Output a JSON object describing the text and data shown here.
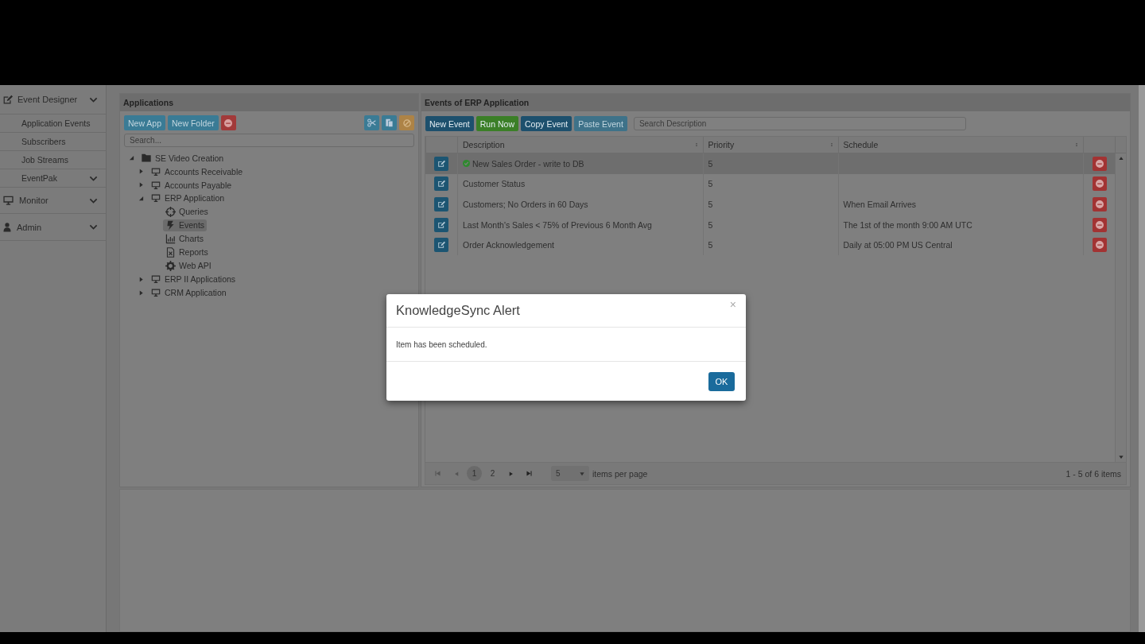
{
  "sidebar": {
    "groups": [
      {
        "label": "Event Designer",
        "children": [
          {
            "label": "Application Events",
            "has_submenu": false
          },
          {
            "label": "Subscribers",
            "has_submenu": false
          },
          {
            "label": "Job Streams",
            "has_submenu": false
          },
          {
            "label": "EventPak",
            "has_submenu": true
          }
        ]
      },
      {
        "label": "Monitor"
      },
      {
        "label": "Admin"
      }
    ]
  },
  "applications": {
    "title": "Applications",
    "buttons": [
      {
        "label": "New App",
        "disabled": true
      },
      {
        "label": "New Folder",
        "disabled": true
      }
    ],
    "search": {
      "placeholder": "Search..."
    },
    "tree": [
      {
        "label": "SE Video Creation",
        "kind": "folder",
        "expanded": true,
        "selected": false,
        "children": [
          {
            "label": "Accounts Receivable",
            "kind": "app",
            "expanded": false,
            "selected": false
          },
          {
            "label": "Accounts Payable",
            "kind": "app",
            "expanded": false,
            "selected": false
          },
          {
            "label": "ERP Application",
            "kind": "app",
            "expanded": true,
            "selected": false,
            "children": [
              {
                "label": "Queries",
                "kind": "queries",
                "selected": false
              },
              {
                "label": "Events",
                "kind": "events",
                "selected": true
              },
              {
                "label": "Charts",
                "kind": "charts",
                "selected": false
              },
              {
                "label": "Reports",
                "kind": "reports",
                "selected": false
              },
              {
                "label": "Web API",
                "kind": "api",
                "selected": false
              }
            ]
          },
          {
            "label": "ERP II Applications",
            "kind": "app",
            "expanded": false,
            "selected": false
          },
          {
            "label": "CRM Application",
            "kind": "app",
            "expanded": false,
            "selected": false
          }
        ]
      }
    ]
  },
  "events": {
    "title": "Events of ERP Application",
    "buttons": [
      {
        "label": "New Event",
        "kind": "primary",
        "disabled": false
      },
      {
        "label": "Run Now",
        "kind": "success",
        "disabled": false
      },
      {
        "label": "Copy Event",
        "kind": "primary",
        "disabled": false
      },
      {
        "label": "Paste Event",
        "kind": "primary",
        "disabled": true
      }
    ],
    "search": {
      "placeholder": "Search Description"
    },
    "columns": [
      "Description",
      "Priority",
      "Schedule"
    ],
    "rows": [
      {
        "description": "New Sales Order - write to DB",
        "priority": "5",
        "schedule": "",
        "ok": true,
        "selected": true
      },
      {
        "description": "Customer Status",
        "priority": "5",
        "schedule": "",
        "ok": false,
        "selected": false
      },
      {
        "description": "Customers; No Orders in 60 Days",
        "priority": "5",
        "schedule": "When Email Arrives",
        "ok": false,
        "selected": false
      },
      {
        "description": "Last Month's Sales < 75% of Previous 6 Month Avg",
        "priority": "5",
        "schedule": "The 1st of the month 9:00 AM UTC",
        "ok": false,
        "selected": false
      },
      {
        "description": "Order Acknowledgement",
        "priority": "5",
        "schedule": "Daily at 05:00 PM US Central",
        "ok": false,
        "selected": false
      }
    ],
    "pager": {
      "pages": [
        {
          "label": "1",
          "selected": true
        },
        {
          "label": "2",
          "selected": false
        }
      ],
      "page_size": "5",
      "per_page_label": "items per page",
      "summary": "1 - 5 of 6 items"
    }
  },
  "dialog": {
    "title": "KnowledgeSync Alert",
    "close": "×",
    "message": "Item has been scheduled.",
    "ok": "OK"
  }
}
